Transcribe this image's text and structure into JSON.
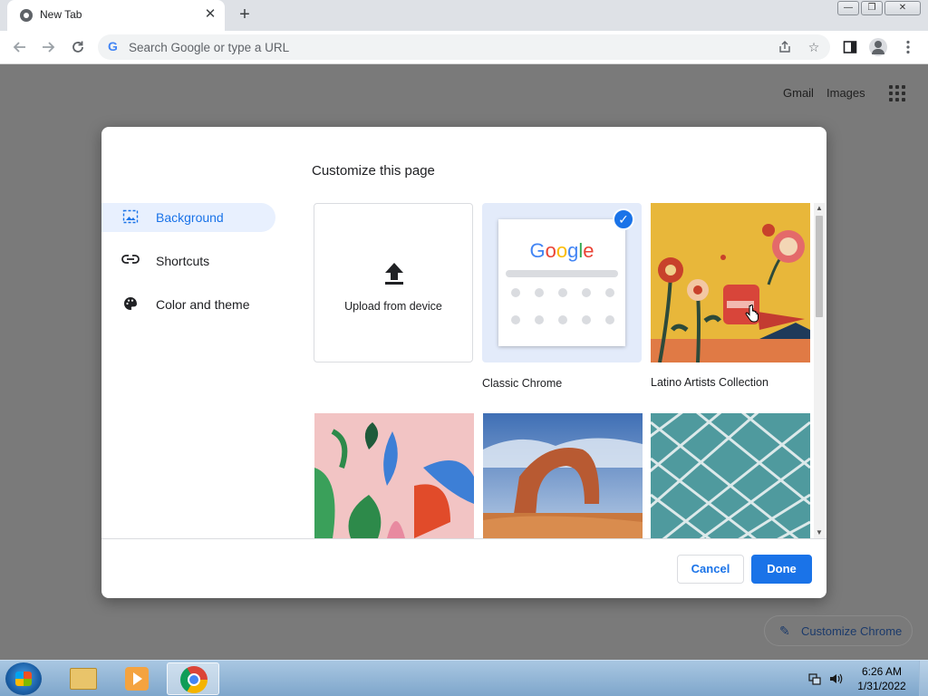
{
  "browser": {
    "tab_title": "New Tab",
    "tab_close_glyph": "✕",
    "new_tab_glyph": "+",
    "window_controls": {
      "minimize": "—",
      "maximize": "❐",
      "close": "✕"
    },
    "omnibox_placeholder": "Search Google or type a URL",
    "omnibox_g": "G"
  },
  "ntp": {
    "gmail_link": "Gmail",
    "images_link": "Images",
    "customize_chrome_label": "Customize Chrome"
  },
  "dialog": {
    "title": "Customize this page",
    "sidebar": [
      {
        "label": "Background",
        "icon": "image-icon",
        "selected": true
      },
      {
        "label": "Shortcuts",
        "icon": "link-icon",
        "selected": false
      },
      {
        "label": "Color and theme",
        "icon": "palette-icon",
        "selected": false
      }
    ],
    "tiles": {
      "upload_label": "Upload from device",
      "classic_label": "Classic Chrome",
      "classic_logo": "Google",
      "latino_label": "Latino Artists Collection"
    },
    "cancel_label": "Cancel",
    "done_label": "Done"
  },
  "taskbar": {
    "time": "6:26 AM",
    "date": "1/31/2022"
  },
  "colors": {
    "accent": "#1a73e8",
    "selected_bg": "#e8f0fe",
    "overlay": "#7a7a7a"
  }
}
